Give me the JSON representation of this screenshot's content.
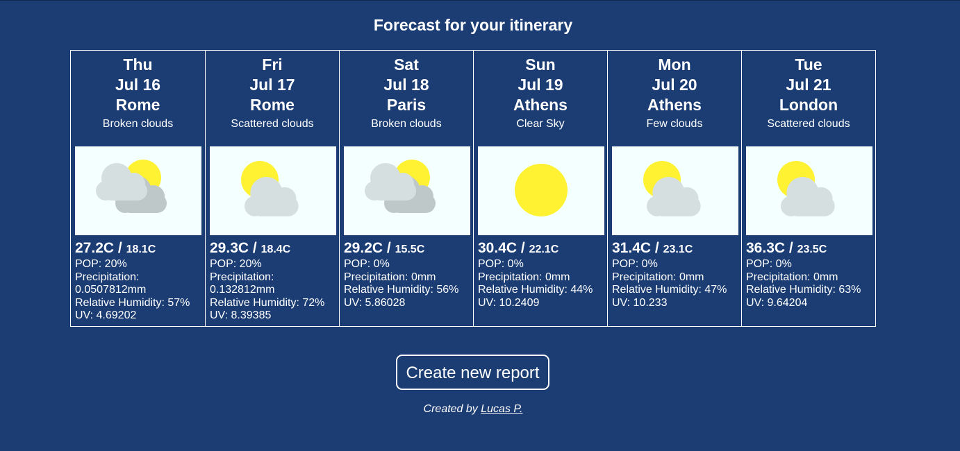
{
  "title": "Forecast for your itinerary",
  "colors": {
    "background": "#1b3d73",
    "sun": "#fef233",
    "cloud_front": "#d6dfdf",
    "cloud_back": "#bfc8c8",
    "icon_bg": "#f4ffff"
  },
  "days": [
    {
      "weekday": "Thu",
      "date": "Jul 16",
      "city": "Rome",
      "condition": "Broken clouds",
      "icon": "broken-clouds-icon",
      "high": "27.2C",
      "low": "18.1C",
      "pop": "POP: 20%",
      "precip": "Precipitation: 0.0507812mm",
      "humidity": "Relative Humidity: 57%",
      "uv": "UV: 4.69202"
    },
    {
      "weekday": "Fri",
      "date": "Jul 17",
      "city": "Rome",
      "condition": "Scattered clouds",
      "icon": "scattered-clouds-icon",
      "high": "29.3C",
      "low": "18.4C",
      "pop": "POP: 20%",
      "precip": "Precipitation: 0.132812mm",
      "humidity": "Relative Humidity: 72%",
      "uv": "UV: 8.39385"
    },
    {
      "weekday": "Sat",
      "date": "Jul 18",
      "city": "Paris",
      "condition": "Broken clouds",
      "icon": "broken-clouds-icon",
      "high": "29.2C",
      "low": "15.5C",
      "pop": "POP: 0%",
      "precip": "Precipitation: 0mm",
      "humidity": "Relative Humidity: 56%",
      "uv": "UV: 5.86028"
    },
    {
      "weekday": "Sun",
      "date": "Jul 19",
      "city": "Athens",
      "condition": "Clear Sky",
      "icon": "clear-sky-icon",
      "high": "30.4C",
      "low": "22.1C",
      "pop": "POP: 0%",
      "precip": "Precipitation: 0mm",
      "humidity": "Relative Humidity: 44%",
      "uv": "UV: 10.2409"
    },
    {
      "weekday": "Mon",
      "date": "Jul 20",
      "city": "Athens",
      "condition": "Few clouds",
      "icon": "few-clouds-icon",
      "high": "31.4C",
      "low": "23.1C",
      "pop": "POP: 0%",
      "precip": "Precipitation: 0mm",
      "humidity": "Relative Humidity: 47%",
      "uv": "UV: 10.233"
    },
    {
      "weekday": "Tue",
      "date": "Jul 21",
      "city": "London",
      "condition": "Scattered clouds",
      "icon": "scattered-clouds-icon",
      "high": "36.3C",
      "low": "23.5C",
      "pop": "POP: 0%",
      "precip": "Precipitation: 0mm",
      "humidity": "Relative Humidity: 63%",
      "uv": "UV: 9.64204"
    }
  ],
  "temp_separator": " / ",
  "create_button_label": "Create new report",
  "credit": {
    "prefix": "Created by ",
    "author": "Lucas P."
  }
}
